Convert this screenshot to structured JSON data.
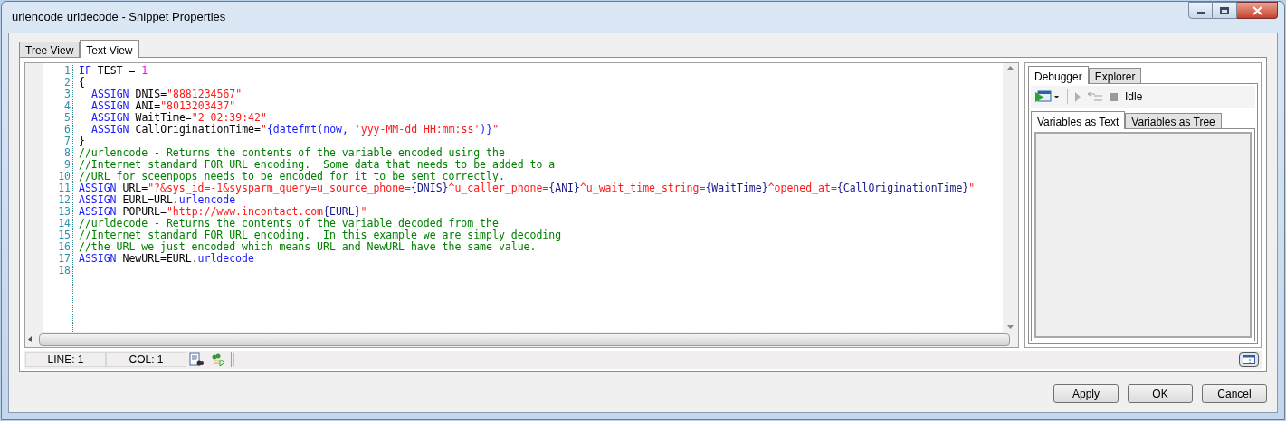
{
  "window": {
    "title": "urlencode urldecode - Snippet Properties"
  },
  "tabs": [
    {
      "label": "Tree View",
      "selected": false
    },
    {
      "label": "Text View",
      "selected": true
    }
  ],
  "editor": {
    "lines": [
      {
        "number": "1",
        "tokens": [
          {
            "kind": "kw",
            "text": "IF"
          },
          {
            "kind": "plain",
            "text": " TEST = "
          },
          {
            "kind": "num",
            "text": "1"
          }
        ]
      },
      {
        "number": "2",
        "tokens": [
          {
            "kind": "plain",
            "text": "{"
          }
        ]
      },
      {
        "number": "3",
        "indented": true,
        "tokens": [
          {
            "kind": "kw",
            "text": "ASSIGN"
          },
          {
            "kind": "plain",
            "text": " DNIS="
          },
          {
            "kind": "str",
            "text": "\"8881234567\""
          }
        ]
      },
      {
        "number": "4",
        "indented": true,
        "tokens": [
          {
            "kind": "kw",
            "text": "ASSIGN"
          },
          {
            "kind": "plain",
            "text": " ANI="
          },
          {
            "kind": "str",
            "text": "\"8013203437\""
          }
        ]
      },
      {
        "number": "5",
        "indented": true,
        "tokens": [
          {
            "kind": "kw",
            "text": "ASSIGN"
          },
          {
            "kind": "plain",
            "text": " WaitTime="
          },
          {
            "kind": "str",
            "text": "\"2 02:39:42\""
          }
        ]
      },
      {
        "number": "6",
        "indented": true,
        "tokens": [
          {
            "kind": "kw",
            "text": "ASSIGN"
          },
          {
            "kind": "plain",
            "text": " CallOriginationTime="
          },
          {
            "kind": "str",
            "text": "\""
          },
          {
            "kind": "expr",
            "text": "{datefmt(now, "
          },
          {
            "kind": "str",
            "text": "'yyy-MM-dd HH:mm:ss'"
          },
          {
            "kind": "expr",
            "text": ")}"
          },
          {
            "kind": "str",
            "text": "\""
          }
        ]
      },
      {
        "number": "7",
        "tokens": [
          {
            "kind": "plain",
            "text": "}"
          }
        ]
      },
      {
        "number": "8",
        "tokens": [
          {
            "kind": "comment",
            "text": "//urlencode - Returns the contents of the variable encoded using the"
          }
        ]
      },
      {
        "number": "9",
        "tokens": [
          {
            "kind": "comment",
            "text": "//Internet standard FOR URL encoding.  Some data that needs to be added to a"
          }
        ]
      },
      {
        "number": "10",
        "tokens": [
          {
            "kind": "comment",
            "text": "//URL for sceenpops needs to be encoded for it to be sent correctly."
          }
        ]
      },
      {
        "number": "11",
        "tokens": [
          {
            "kind": "kw",
            "text": "ASSIGN"
          },
          {
            "kind": "plain",
            "text": " URL="
          },
          {
            "kind": "str",
            "text": "\"?&sys_id=-1&sysparm_query=u_source_phone="
          },
          {
            "kind": "var",
            "text": "{DNIS}"
          },
          {
            "kind": "str",
            "text": "^u_caller_phone="
          },
          {
            "kind": "var",
            "text": "{ANI}"
          },
          {
            "kind": "str",
            "text": "^u_wait_time_string="
          },
          {
            "kind": "var",
            "text": "{WaitTime}"
          },
          {
            "kind": "str",
            "text": "^opened_at="
          },
          {
            "kind": "var",
            "text": "{CallOriginationTime}"
          },
          {
            "kind": "str",
            "text": "\""
          }
        ]
      },
      {
        "number": "12",
        "tokens": [
          {
            "kind": "kw",
            "text": "ASSIGN"
          },
          {
            "kind": "plain",
            "text": " EURL=URL."
          },
          {
            "kind": "expr",
            "text": "urlencode"
          }
        ]
      },
      {
        "number": "13",
        "tokens": [
          {
            "kind": "kw",
            "text": "ASSIGN"
          },
          {
            "kind": "plain",
            "text": " POPURL="
          },
          {
            "kind": "str",
            "text": "\"http://www.incontact.com"
          },
          {
            "kind": "var",
            "text": "{EURL}"
          },
          {
            "kind": "str",
            "text": "\""
          }
        ]
      },
      {
        "number": "14",
        "tokens": [
          {
            "kind": "comment",
            "text": "//urldecode - Returns the contents of the variable decoded from the"
          }
        ]
      },
      {
        "number": "15",
        "tokens": [
          {
            "kind": "comment",
            "text": "//Internet standard FOR URL encoding.  In this example we are simply decoding"
          }
        ]
      },
      {
        "number": "16",
        "tokens": [
          {
            "kind": "comment",
            "text": "//the URL we just encoded which means URL and NewURL have the same value."
          }
        ]
      },
      {
        "number": "17",
        "tokens": [
          {
            "kind": "kw",
            "text": "ASSIGN"
          },
          {
            "kind": "plain",
            "text": " NewURL=EURL."
          },
          {
            "kind": "expr",
            "text": "urldecode"
          }
        ]
      },
      {
        "number": "18"
      }
    ]
  },
  "status_bar": {
    "line": "LINE: 1",
    "col": "COL: 1"
  },
  "debugger": {
    "tabs": [
      {
        "label": "Debugger",
        "selected": true
      },
      {
        "label": "Explorer",
        "selected": false
      }
    ],
    "status": "Idle",
    "variable_tabs": [
      {
        "label": "Variables as Text",
        "selected": true
      },
      {
        "label": "Variables as Tree",
        "selected": false
      }
    ]
  },
  "buttons": [
    "Apply",
    "OK",
    "Cancel"
  ]
}
